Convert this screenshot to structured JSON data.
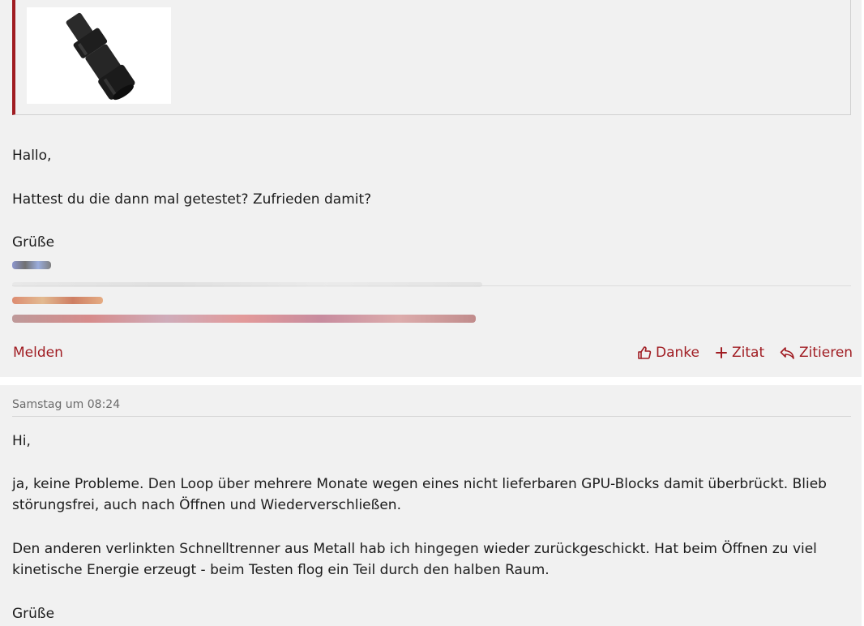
{
  "post1": {
    "quote_image_alt": "black plastic quick-disconnect coupling",
    "greeting": "Hallo,",
    "question": "Hattest du die dann mal getestet? Zufrieden damit?",
    "closing": "Grüße",
    "report_label": "Melden",
    "actions": {
      "thanks_label": "Danke",
      "quote_add_label": "Zitat",
      "quote_reply_label": "Zitieren"
    }
  },
  "post2": {
    "timestamp": "Samstag um 08:24",
    "greeting": "Hi,",
    "para1_line1": "ja, keine Probleme. Den Loop über mehrere Monate wegen eines nicht lieferbaren GPU-Blocks damit überbrückt. Blieb",
    "para1_line2": "störungsfrei, auch nach Öffnen und Wiederverschließen.",
    "para2_line1": "Den anderen verlinkten Schnelltrenner aus Metall hab ich hingegen wieder zurückgeschickt. Hat beim Öffnen zu viel",
    "para2_line2": "kinetische Energie erzeugt - beim Testen flog ein Teil durch den halben Raum.",
    "closing": "Grüße"
  },
  "colors": {
    "accent": "#a01c22",
    "post_background": "#f1f1f1"
  }
}
